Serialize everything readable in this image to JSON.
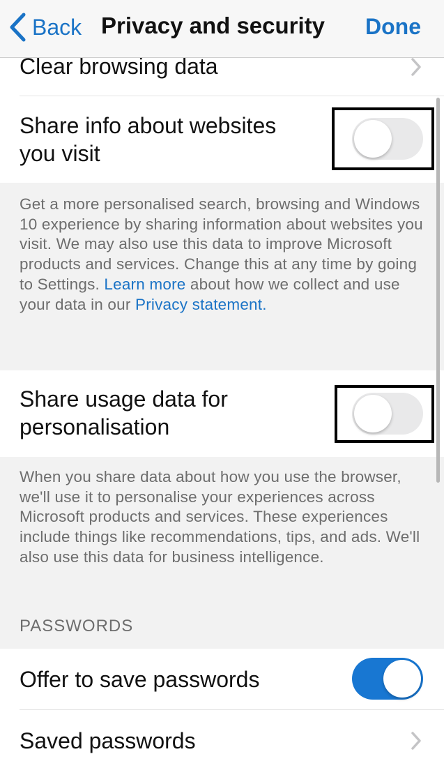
{
  "navbar": {
    "back_label": "Back",
    "title": "Privacy and security",
    "done_label": "Done"
  },
  "rows": {
    "clear_browsing": {
      "label": "Clear browsing data"
    },
    "share_websites": {
      "label_line1": "Share info about websites",
      "label_line2": "you visit",
      "toggle_on": false
    },
    "share_websites_desc": {
      "text_before_link": "Get a more personalised search, browsing and Windows 10 experience by sharing information about websites you visit. We may also use this data to improve Microsoft products and services. Change this at any time by going to Settings. ",
      "learn_more": "Learn more",
      "text_middle": " about how we collect and use your data in our ",
      "privacy_statement": "Privacy statement",
      "text_end": "."
    },
    "share_usage": {
      "label_line1": "Share usage data for",
      "label_line2": "personalisation",
      "toggle_on": false
    },
    "share_usage_desc": {
      "text": "When you share data about how you use the browser, we'll use it to personalise your experiences across Microsoft products and services. These experiences include things like recommendations, tips, and ads. We'll also use this data for business intelligence."
    }
  },
  "passwords_section": {
    "header": "PASSWORDS",
    "offer_save": {
      "label": "Offer to save passwords",
      "toggle_on": true
    },
    "saved_passwords": {
      "label": "Saved passwords"
    }
  },
  "colors": {
    "accent": "#1a73c6",
    "toggle_on": "#1877d2",
    "toggle_off": "#e9e9ea",
    "secondary_text": "#6d6d6d"
  },
  "icons": {
    "back": "chevron-left-icon",
    "disclosure": "chevron-right-icon"
  }
}
